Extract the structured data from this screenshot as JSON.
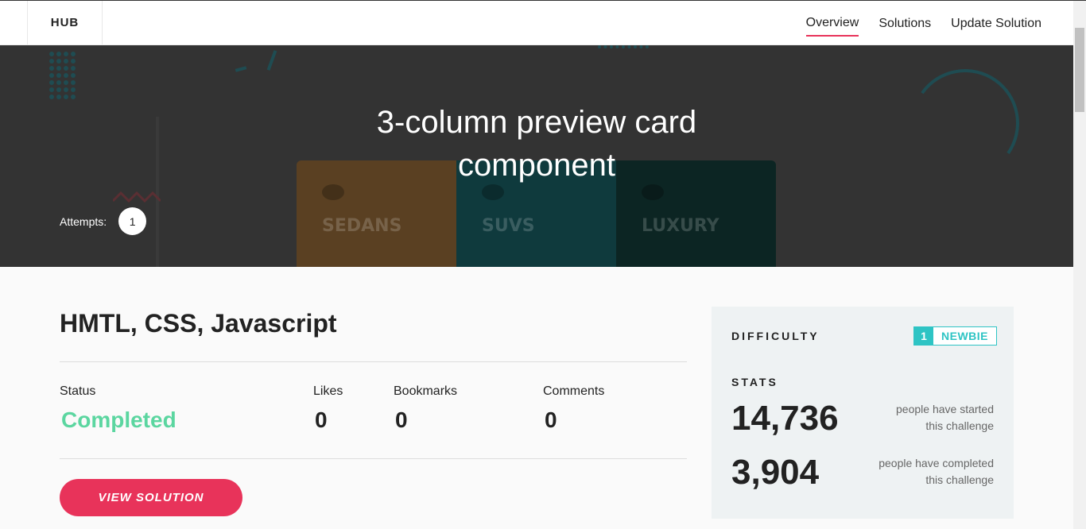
{
  "nav": {
    "logo": "HUB",
    "links": [
      {
        "label": "Overview",
        "active": true
      },
      {
        "label": "Solutions",
        "active": false
      },
      {
        "label": "Update Solution",
        "active": false
      }
    ]
  },
  "hero": {
    "title_line1": "3-column preview card",
    "title_line2": "component",
    "attempts_label": "Attempts:",
    "attempts_count": "1",
    "preview_columns": [
      "SEDANS",
      "SUVS",
      "LUXURY"
    ]
  },
  "main": {
    "tech_title": "HMTL, CSS, Javascript",
    "stats": [
      {
        "label": "Status",
        "value": "Completed"
      },
      {
        "label": "Likes",
        "value": "0"
      },
      {
        "label": "Bookmarks",
        "value": "0"
      },
      {
        "label": "Comments",
        "value": "0"
      }
    ],
    "view_solution_label": "VIEW SOLUTION"
  },
  "sidebar": {
    "difficulty_heading": "DIFFICULTY",
    "difficulty_level": "1",
    "difficulty_name": "NEWBIE",
    "stats_heading": "STATS",
    "started_count": "14,736",
    "started_caption_1": "people have started",
    "started_caption_2": "this challenge",
    "completed_count": "3,904",
    "completed_caption_1": "people have completed",
    "completed_caption_2": "this challenge"
  },
  "colors": {
    "accent": "#e8335a",
    "status_completed": "#5bd6a0",
    "difficulty": "#2ec4c4",
    "hero_bg": "#333333"
  }
}
